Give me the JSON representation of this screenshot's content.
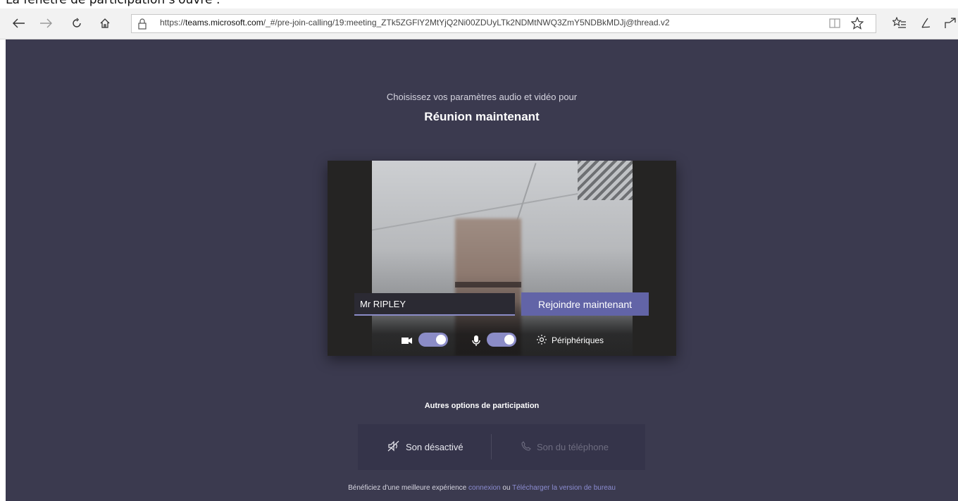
{
  "caption": "La fenêtre de participation s'ouvre :",
  "browser": {
    "url_prefix": "https://",
    "url_domain": "teams.microsoft.com",
    "url_path": "/_#/pre-join-calling/19:meeting_ZTk5ZGFlY2MtYjQ2Ni00ZDUyLTk2NDMtNWQ3ZmY5NDBkMDJj@thread.v2",
    "icons": [
      "back-icon",
      "forward-icon",
      "refresh-icon",
      "home-icon",
      "lock-icon",
      "reading-view-icon",
      "favorite-star-icon",
      "favorites-list-icon",
      "pen-icon",
      "share-icon"
    ]
  },
  "prejoin": {
    "subtitle": "Choisissez vos paramètres audio et vidéo pour",
    "title": "Réunion maintenant",
    "name_value": "Mr RIPLEY",
    "join_label": "Rejoindre maintenant",
    "camera_on": true,
    "mic_on": true,
    "devices_label": "Périphériques"
  },
  "other_options": {
    "title": "Autres options de participation",
    "audio_off_label": "Son désactivé",
    "phone_label": "Son du téléphone"
  },
  "footer": {
    "text": "Bénéficiez d'une meilleure expérience",
    "signin_link": "connexion",
    "or": "ou",
    "download_link": "Télécharger la version de bureau"
  },
  "colors": {
    "accent": "#6264a7",
    "background": "#3b3a4f"
  }
}
